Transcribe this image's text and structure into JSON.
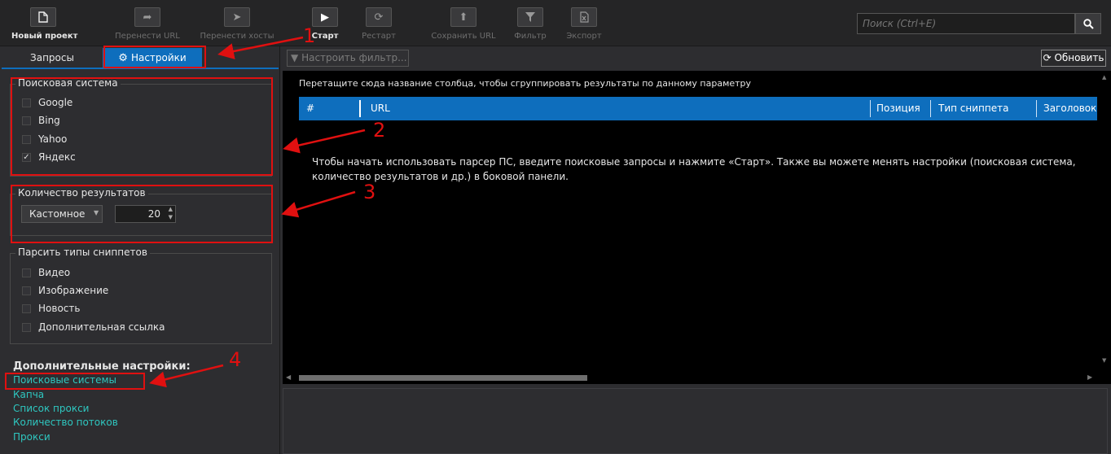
{
  "toolbar": {
    "buttons": [
      {
        "label": "Новый проект",
        "icon": "file-icon",
        "state": "enabled"
      },
      {
        "label": "Перенести URL",
        "icon": "share-icon",
        "state": "disabled"
      },
      {
        "label": "Перенести хосты",
        "icon": "send-icon",
        "state": "disabled"
      },
      {
        "label": "Старт",
        "icon": "play-icon",
        "state": "active"
      },
      {
        "label": "Рестарт",
        "icon": "refresh-icon",
        "state": "disabled"
      },
      {
        "label": "Сохранить URL",
        "icon": "upload-icon",
        "state": "disabled"
      },
      {
        "label": "Фильтр",
        "icon": "filter-icon",
        "state": "disabled"
      },
      {
        "label": "Экспорт",
        "icon": "excel-icon",
        "state": "disabled"
      }
    ],
    "search": {
      "placeholder": "Поиск (Ctrl+E)",
      "value": ""
    }
  },
  "left_panel": {
    "tabs": [
      {
        "label": "Запросы",
        "selected": false
      },
      {
        "label": "Настройки",
        "selected": true,
        "icon": "gear-icon"
      }
    ],
    "search_engine": {
      "title": "Поисковая система",
      "options": [
        {
          "label": "Google",
          "checked": false
        },
        {
          "label": "Bing",
          "checked": false
        },
        {
          "label": "Yahoo",
          "checked": false
        },
        {
          "label": "Яндекс",
          "checked": true
        }
      ]
    },
    "results_count": {
      "title": "Количество результатов",
      "mode": "Кастомное",
      "value": "20"
    },
    "snippet_types": {
      "title": "Парсить типы сниппетов",
      "options": [
        {
          "label": "Видео",
          "checked": false
        },
        {
          "label": "Изображение",
          "checked": false
        },
        {
          "label": "Новость",
          "checked": false
        },
        {
          "label": "Дополнительная ссылка",
          "checked": false
        }
      ]
    },
    "additional": {
      "title": "Дополнительные настройки:",
      "links": [
        "Поисковые системы",
        "Капча",
        "Список прокси",
        "Количество потоков",
        "Прокси"
      ]
    }
  },
  "main": {
    "filter_button": "Настроить фильтр...",
    "refresh_button": "Обновить",
    "group_hint": "Перетащите сюда название столбца, чтобы сгруппировать результаты по данному параметру",
    "columns": [
      "#",
      "URL",
      "Позиция",
      "Тип сниппета",
      "Заголовок"
    ],
    "empty_message": "Чтобы начать использовать парсер ПС, введите поисковые запросы и нажмите «Старт». Также вы можете менять настройки (поисковая система, количество результатов и др.) в боковой панели."
  },
  "annotations": [
    "1",
    "2",
    "3",
    "4"
  ],
  "colors": {
    "accent": "#0e6ebd",
    "annotation": "#e01010",
    "link": "#2ec7c0"
  }
}
